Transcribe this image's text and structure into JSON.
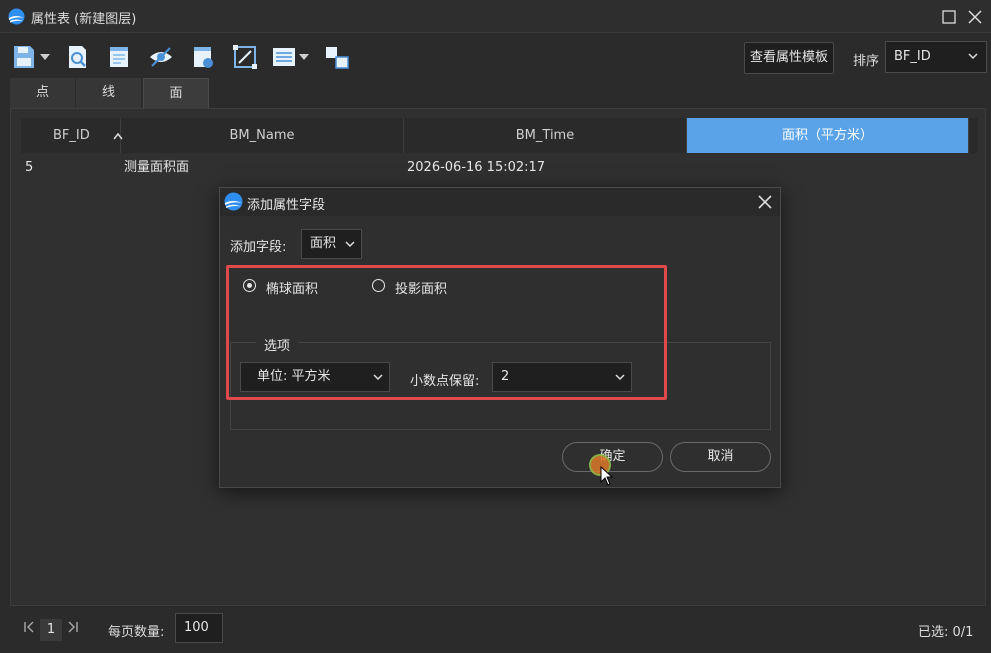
{
  "window": {
    "title": "属性表 (新建图层)"
  },
  "toolbar": {
    "template_button": "查看属性模板",
    "sort_label": "排序",
    "sort_value": "BF_ID"
  },
  "tabs": [
    {
      "label": "点"
    },
    {
      "label": "线"
    },
    {
      "label": "面",
      "active": true
    }
  ],
  "table": {
    "columns": [
      "BF_ID",
      "BM_Name",
      "BM_Time",
      "面积（平方米）"
    ],
    "rows": [
      [
        "5",
        "测量面积面",
        "2026-06-16 15:02:17",
        ""
      ]
    ]
  },
  "footer": {
    "page": "1",
    "per_page_label": "每页数量:",
    "per_page_value": "100",
    "selected": "已选: 0/1"
  },
  "dialog": {
    "title": "添加属性字段",
    "field_label": "添加字段:",
    "field_value": "面积",
    "radio_ellipsoid": "椭球面积",
    "radio_projected": "投影面积",
    "selected_radio": "ellipsoid",
    "options_legend": "选项",
    "unit_value": "单位: 平方米",
    "decimal_label": "小数点保留:",
    "decimal_value": "2",
    "ok_label": "确定",
    "cancel_label": "取消"
  },
  "colors": {
    "accent_header": "#5aa3e8",
    "highlight": "#e0494c",
    "background": "#2b2b2b"
  },
  "icons": [
    "app-logo-icon",
    "maximize-icon",
    "close-icon",
    "save-icon",
    "search-doc-icon",
    "document-icon",
    "eye-hide-icon",
    "export-doc-icon",
    "edit-frame-icon",
    "list-icon",
    "layers-icon",
    "chevron-down-icon",
    "first-page-icon",
    "last-page-icon"
  ]
}
